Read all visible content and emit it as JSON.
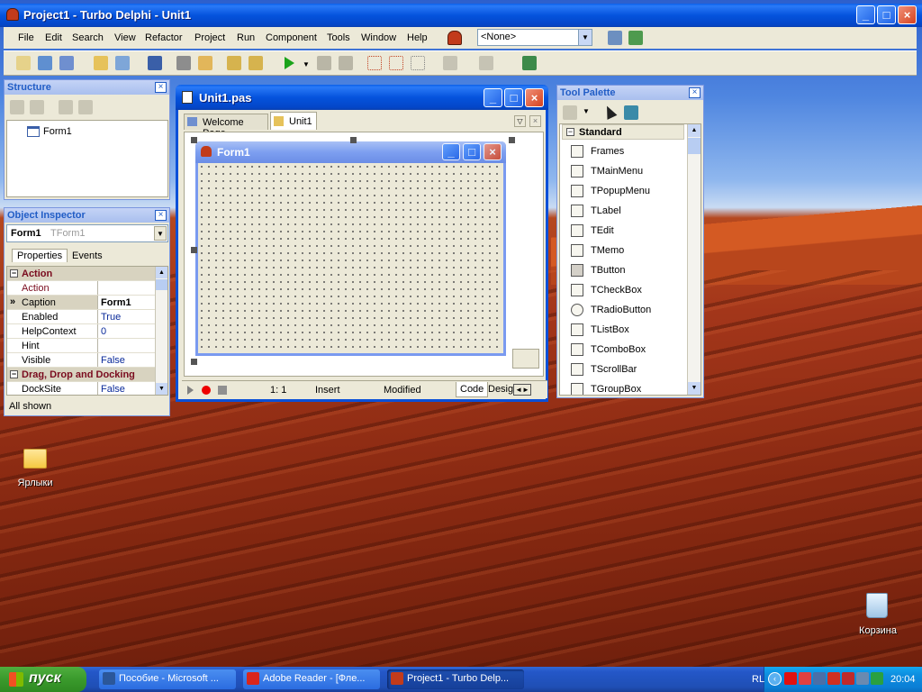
{
  "main_window": {
    "title": "Project1 - Turbo Delphi - Unit1"
  },
  "menu": [
    {
      "label": "File"
    },
    {
      "label": "Edit"
    },
    {
      "label": "Search"
    },
    {
      "label": "View"
    },
    {
      "label": "Refactor"
    },
    {
      "label": "Project"
    },
    {
      "label": "Run"
    },
    {
      "label": "Component"
    },
    {
      "label": "Tools"
    },
    {
      "label": "Window"
    },
    {
      "label": "Help"
    }
  ],
  "desktop_combo": {
    "value": "<None>"
  },
  "structure": {
    "title": "Structure",
    "tree_item": "Form1"
  },
  "object_inspector": {
    "title": "Object Inspector",
    "selector_name": "Form1",
    "selector_type": "TForm1",
    "tabs": [
      "Properties",
      "Events"
    ],
    "rows": [
      {
        "key": "Action",
        "value": "",
        "category": true
      },
      {
        "key": "Action",
        "value": ""
      },
      {
        "key": "Caption",
        "value": "Form1",
        "selected": true
      },
      {
        "key": "Enabled",
        "value": "True"
      },
      {
        "key": "HelpContext",
        "value": "0"
      },
      {
        "key": "Hint",
        "value": ""
      },
      {
        "key": "Visible",
        "value": "False"
      },
      {
        "key": "Drag, Drop and Docking",
        "value": "",
        "category": true
      },
      {
        "key": "DockSite",
        "value": "False"
      }
    ],
    "status": "All shown"
  },
  "editor": {
    "title": "Unit1.pas",
    "tabs": [
      "Welcome Page",
      "Unit1"
    ],
    "form_caption": "Form1",
    "status": {
      "position": "1:   1",
      "mode": "Insert",
      "modified": "Modified"
    },
    "bottom_tabs": [
      "Code",
      "Desig"
    ]
  },
  "tool_palette": {
    "title": "Tool Palette",
    "category": "Standard",
    "items": [
      "Frames",
      "TMainMenu",
      "TPopupMenu",
      "TLabel",
      "TEdit",
      "TMemo",
      "TButton",
      "TCheckBox",
      "TRadioButton",
      "TListBox",
      "TComboBox",
      "TScrollBar",
      "TGroupBox"
    ]
  },
  "desktop_icons": [
    {
      "label": "Ярлыки"
    },
    {
      "label": "Корзина"
    }
  ],
  "taskbar": {
    "start": "пуск",
    "tasks": [
      "Пособие - Microsoft ...",
      "Adobe Reader - [Фле...",
      "Project1 - Turbo Delp..."
    ],
    "tray_lang": "RL",
    "clock": "20:04"
  }
}
